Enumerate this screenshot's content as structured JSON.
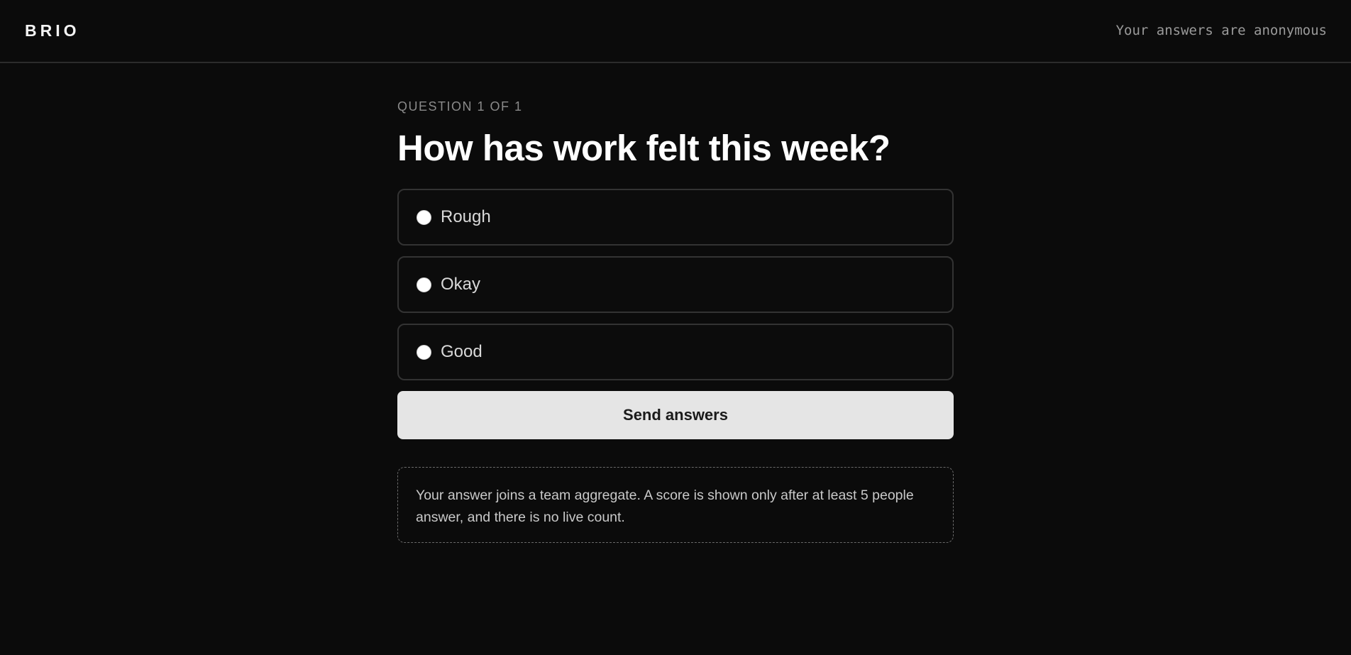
{
  "header": {
    "brand": "BRIO",
    "anonymity_note": "Your answers are anonymous"
  },
  "survey": {
    "step_label": "QUESTION 1 OF 1",
    "question": "How has work felt this week?",
    "options": [
      {
        "label": "Rough",
        "selected": false
      },
      {
        "label": "Okay",
        "selected": false
      },
      {
        "label": "Good",
        "selected": false
      }
    ],
    "submit_label": "Send answers",
    "privacy_note": "Your answer joins a team aggregate. A score is shown only after at least 5 people answer, and there is no live count."
  },
  "colors": {
    "background": "#0b0b0b",
    "button": "#e5e5e5",
    "border": "#333333"
  }
}
